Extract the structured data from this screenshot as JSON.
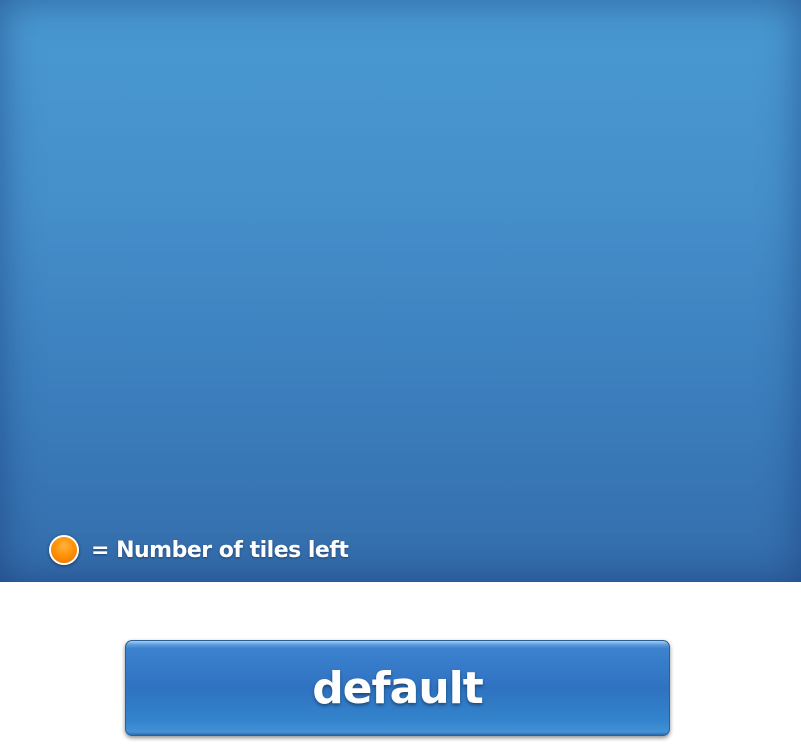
{
  "board": {
    "background_color": "#4490cc"
  },
  "legend": {
    "icon": "orange-circle-icon",
    "icon_color": "#ff8c00",
    "text": "= Number of tiles left"
  },
  "button": {
    "label": "default",
    "color": "#3a7fcc"
  }
}
